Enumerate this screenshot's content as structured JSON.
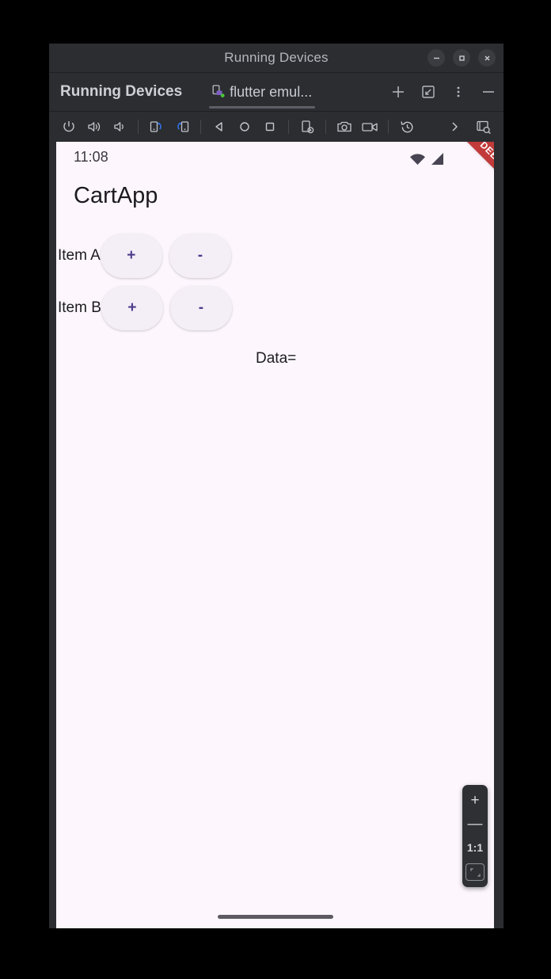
{
  "window": {
    "title": "Running Devices",
    "controls": [
      {
        "name": "minimize-button",
        "glyph": "–"
      },
      {
        "name": "maximize-button",
        "glyph": "□"
      },
      {
        "name": "close-button",
        "glyph": "×"
      }
    ]
  },
  "panel": {
    "title": "Running Devices",
    "device_tab": {
      "label": "flutter emul...",
      "icon": "device-running-icon",
      "active": true
    },
    "actions": [
      {
        "name": "add-device-button",
        "icon": "plus-icon",
        "label": "+"
      },
      {
        "name": "detach-window-button",
        "icon": "arrow-into-corner-icon",
        "label": ""
      },
      {
        "name": "more-options-button",
        "icon": "vertical-dots-icon",
        "label": "⋮"
      },
      {
        "name": "minimize-panel-button",
        "icon": "minus-icon",
        "label": "—"
      }
    ]
  },
  "device_toolbar": [
    {
      "name": "power-button",
      "icon": "power-icon"
    },
    {
      "name": "volume-up-button",
      "icon": "volume-up-icon"
    },
    {
      "name": "volume-down-button",
      "icon": "volume-down-icon"
    },
    {
      "name": "rotate-right-button",
      "icon": "rotate-right-icon"
    },
    {
      "name": "rotate-left-button",
      "icon": "rotate-left-icon"
    },
    {
      "name": "back-button",
      "icon": "back-triangle-icon"
    },
    {
      "name": "home-button",
      "icon": "home-circle-icon"
    },
    {
      "name": "overview-button",
      "icon": "overview-square-icon"
    },
    {
      "name": "device-settings-button",
      "icon": "device-gear-icon"
    },
    {
      "name": "screenshot-button",
      "icon": "camera-icon"
    },
    {
      "name": "record-screen-button",
      "icon": "video-camera-icon"
    },
    {
      "name": "reset-history-button",
      "icon": "history-rewind-icon"
    },
    {
      "name": "more-toolbar-button",
      "icon": "chevron-right-icon"
    },
    {
      "name": "layout-inspector-button",
      "icon": "layout-inspect-icon"
    }
  ],
  "device_screen": {
    "status_bar": {
      "time": "11:08",
      "icons": [
        {
          "name": "wifi-icon"
        },
        {
          "name": "cell-signal-icon"
        }
      ]
    },
    "debug_banner": "DEBUG",
    "app": {
      "title": "CartApp",
      "rows": [
        {
          "label": "Item A",
          "increment_label": "+",
          "decrement_label": "-"
        },
        {
          "label": "Item B",
          "increment_label": "+",
          "decrement_label": "-"
        }
      ],
      "data_text": "Data="
    },
    "gesture_bar": true
  },
  "zoom_control": {
    "zoom_in_label": "+",
    "zoom_out_label": "—",
    "actual_size_label": "1:1",
    "fit_label": "fit-screen-icon"
  },
  "colors": {
    "ide_chrome": "#2b2d30",
    "titlebar_text": "#b4b7bd",
    "accent_blue": "#3574f0",
    "device_bg": "#fdf7fd",
    "pill_bg": "#f4eef7",
    "pill_text": "#4b3c8c",
    "debug_red": "#c23a3a",
    "tab_icon_purple": "#8a6fc9",
    "tab_dot_green": "#49c639"
  }
}
